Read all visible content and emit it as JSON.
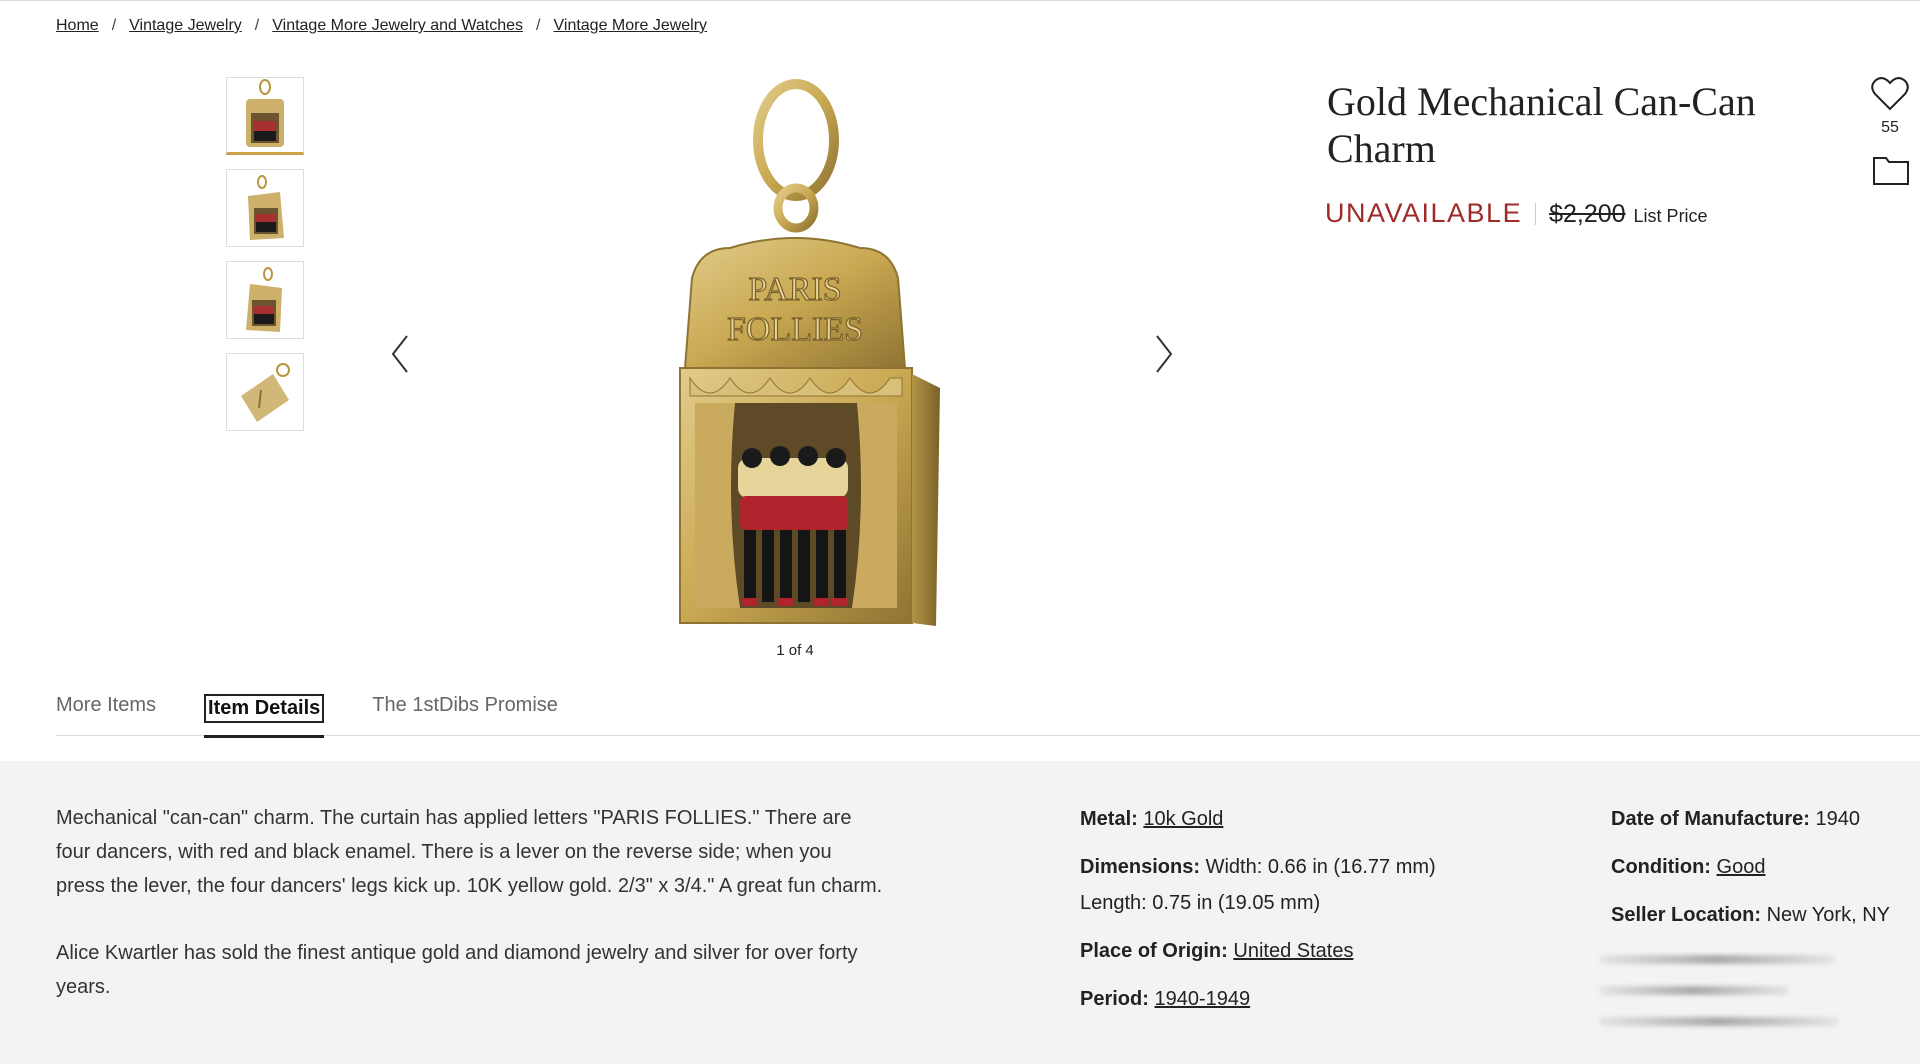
{
  "breadcrumb": {
    "items": [
      "Home",
      "Vintage Jewelry",
      "Vintage More Jewelry and Watches",
      "Vintage More Jewelry"
    ],
    "separator": "/"
  },
  "gallery": {
    "thumbnails": [
      "thumbnail-front",
      "thumbnail-angled-left",
      "thumbnail-angled-right",
      "thumbnail-back"
    ],
    "counter": "1 of 4",
    "image_text": "PARIS FOLLIES"
  },
  "product": {
    "title": "Gold Mechanical Can-Can Charm",
    "status": "UNAVAILABLE",
    "price": "$2,200",
    "price_label": "List Price",
    "favorites_count": "55"
  },
  "tabs": [
    "More Items",
    "Item Details",
    "The 1stDibs Promise"
  ],
  "active_tab": "Item Details",
  "description": {
    "paragraphs": [
      "Mechanical \"can-can\" charm. The curtain has applied letters \"PARIS FOLLIES.\" There are four dancers, with red and black enamel. There is a lever on the reverse side; when you press the lever, the four dancers' legs kick up. 10K yellow gold. 2/3\" x 3/4.\" A great fun charm.",
      "Alice Kwartler has sold the finest antique gold and diamond jewelry and silver for over forty years."
    ]
  },
  "specs": {
    "metal_label": "Metal:",
    "metal_value": "10k Gold",
    "dimensions_label": "Dimensions:",
    "dimensions_width": "Width: 0.66 in (16.77 mm)",
    "dimensions_length": "Length: 0.75 in (19.05 mm)",
    "origin_label": "Place of Origin:",
    "origin_value": "United States",
    "period_label": "Period:",
    "period_value": "1940-1949",
    "date_label": "Date of Manufacture:",
    "date_value": "1940",
    "condition_label": "Condition:",
    "condition_value": "Good",
    "location_label": "Seller Location:",
    "location_value": "New York, NY"
  },
  "colors": {
    "unavailable": "#a02a2a",
    "gold": "#c9a24a",
    "details_bg": "#f3f3f3"
  }
}
